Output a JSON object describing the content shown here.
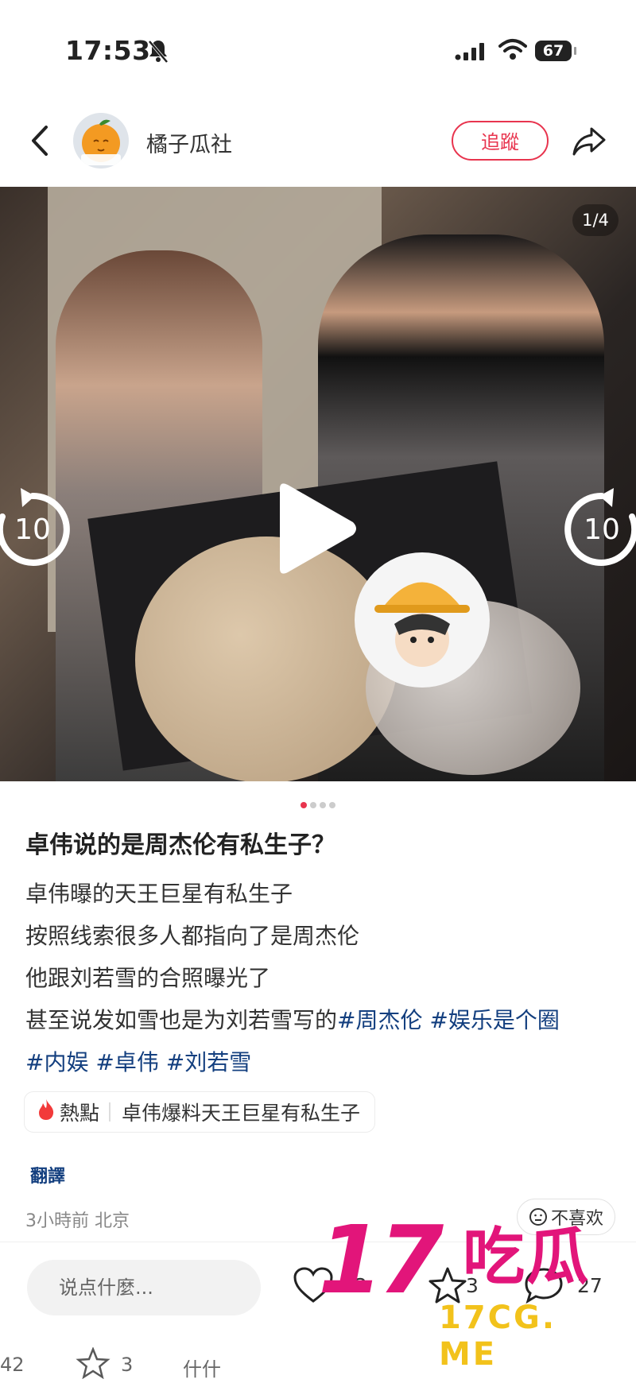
{
  "status_bar": {
    "time": "17:53",
    "battery": "67"
  },
  "header": {
    "author_name": "橘子瓜社",
    "avatar_text": "橘子瓜社",
    "follow_label": "追蹤"
  },
  "media": {
    "counter": "1/4",
    "rewind_seconds": "10",
    "forward_seconds": "10",
    "slides_total": 4,
    "active_slide": 1
  },
  "post": {
    "title": "卓伟说的是周杰伦有私生子？",
    "lines": [
      "卓伟曝的天王巨星有私生子",
      "按照线索很多人都指向了是周杰伦",
      "他跟刘若雪的合照曝光了",
      "甚至说发如雪也是为刘若雪写的"
    ],
    "tags": [
      "#周杰伦",
      "#娱乐是个圈",
      "#内娱",
      "#卓伟",
      "#刘若雪"
    ]
  },
  "hot_topic": {
    "label": "熱點",
    "text": "卓伟爆料天王巨星有私生子"
  },
  "translate_label": "翻譯",
  "meta": {
    "time_location": "3小時前 北京"
  },
  "dislike_label": "不喜欢",
  "bottom_bar": {
    "comment_placeholder": "说点什麼...",
    "like_count": "2",
    "star_count": "3",
    "comment_count": "27"
  },
  "ghost_row": {
    "like_count": "42",
    "star_count": "3",
    "text": "什什"
  },
  "watermark": {
    "big": "17",
    "cn": "吃瓜",
    "url": "17CG. ME"
  },
  "colors": {
    "accent": "#e8344e",
    "tag": "#133f7f",
    "watermark_pink": "#e2157a",
    "watermark_yellow": "#f2c21b"
  }
}
